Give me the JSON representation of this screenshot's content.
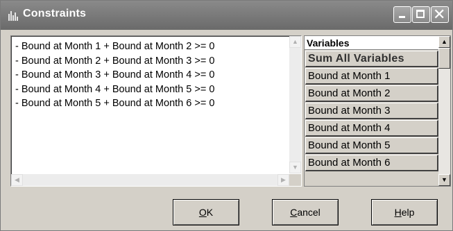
{
  "window": {
    "title": "Constraints",
    "controls": {
      "minimize": "minimize",
      "maximize": "maximize",
      "close": "✕"
    }
  },
  "constraints": {
    "lines": [
      "- Bound at Month 1 + Bound at Month 2 >= 0",
      "- Bound at Month 2 + Bound at Month 3 >= 0",
      "- Bound at Month 3 + Bound at Month 4 >= 0",
      "- Bound at Month 4 + Bound at Month 5 >= 0",
      "- Bound at Month 5 + Bound at Month 6 >= 0"
    ]
  },
  "variables": {
    "header": "Variables",
    "items": [
      "Sum All Variables",
      "Bound at Month 1",
      "Bound at Month 2",
      "Bound at Month 3",
      "Bound at Month 4",
      "Bound at Month 5",
      "Bound at Month 6"
    ]
  },
  "buttons": {
    "ok": {
      "mnemonic": "O",
      "rest": "K"
    },
    "cancel": {
      "mnemonic": "C",
      "rest": "ancel"
    },
    "help": {
      "mnemonic": "H",
      "rest": "elp"
    }
  },
  "colors": {
    "titlebar": "#7a7a7a",
    "dialog": "#d4d0c8"
  }
}
